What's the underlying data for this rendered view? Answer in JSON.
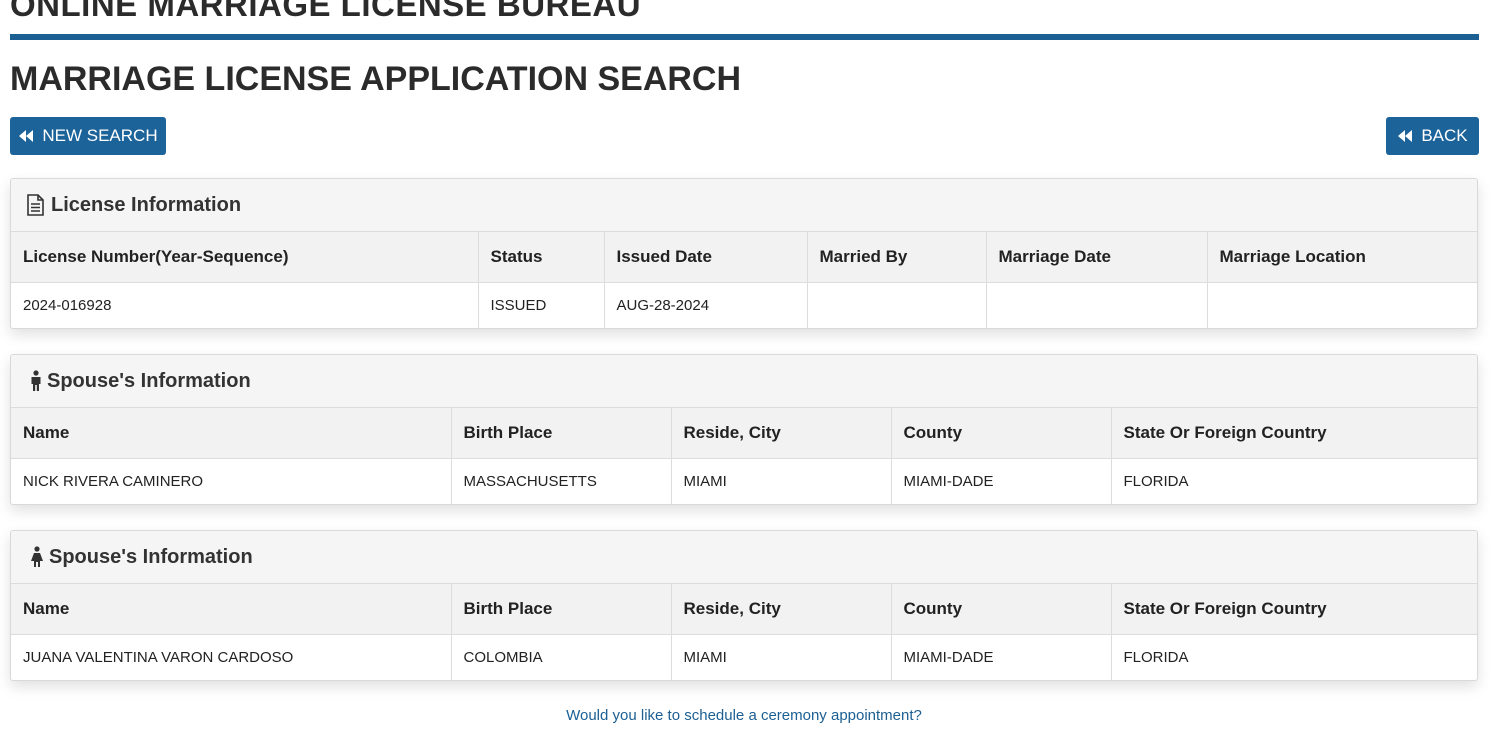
{
  "header": {
    "site_title": "ONLINE MARRIAGE LICENSE BUREAU",
    "page_title": "MARRIAGE LICENSE APPLICATION SEARCH",
    "rule_color": "#1c5f93"
  },
  "buttons": {
    "new_search": "NEW SEARCH",
    "back": "BACK",
    "icon": "fast-backward-icon",
    "color": "#1c6399"
  },
  "license": {
    "title": "License Information",
    "icon": "document-icon",
    "columns": [
      "License Number(Year-Sequence)",
      "Status",
      "Issued Date",
      "Married By",
      "Marriage Date",
      "Marriage Location"
    ],
    "row": [
      "2024-016928",
      "ISSUED",
      "AUG-28-2024",
      "",
      "",
      ""
    ]
  },
  "spouse1": {
    "title": "Spouse's Information",
    "icon": "male-icon",
    "columns": [
      "Name",
      "Birth Place",
      "Reside, City",
      "County",
      "State Or Foreign Country"
    ],
    "row": [
      "NICK RIVERA CAMINERO",
      "MASSACHUSETTS",
      "MIAMI",
      "MIAMI-DADE",
      "FLORIDA"
    ]
  },
  "spouse2": {
    "title": "Spouse's Information",
    "icon": "female-icon",
    "columns": [
      "Name",
      "Birth Place",
      "Reside, City",
      "County",
      "State Or Foreign Country"
    ],
    "row": [
      "JUANA VALENTINA VARON CARDOSO",
      "COLOMBIA",
      "MIAMI",
      "MIAMI-DADE",
      "FLORIDA"
    ]
  },
  "footer": {
    "ceremony_link": "Would you like to schedule a ceremony appointment?"
  }
}
